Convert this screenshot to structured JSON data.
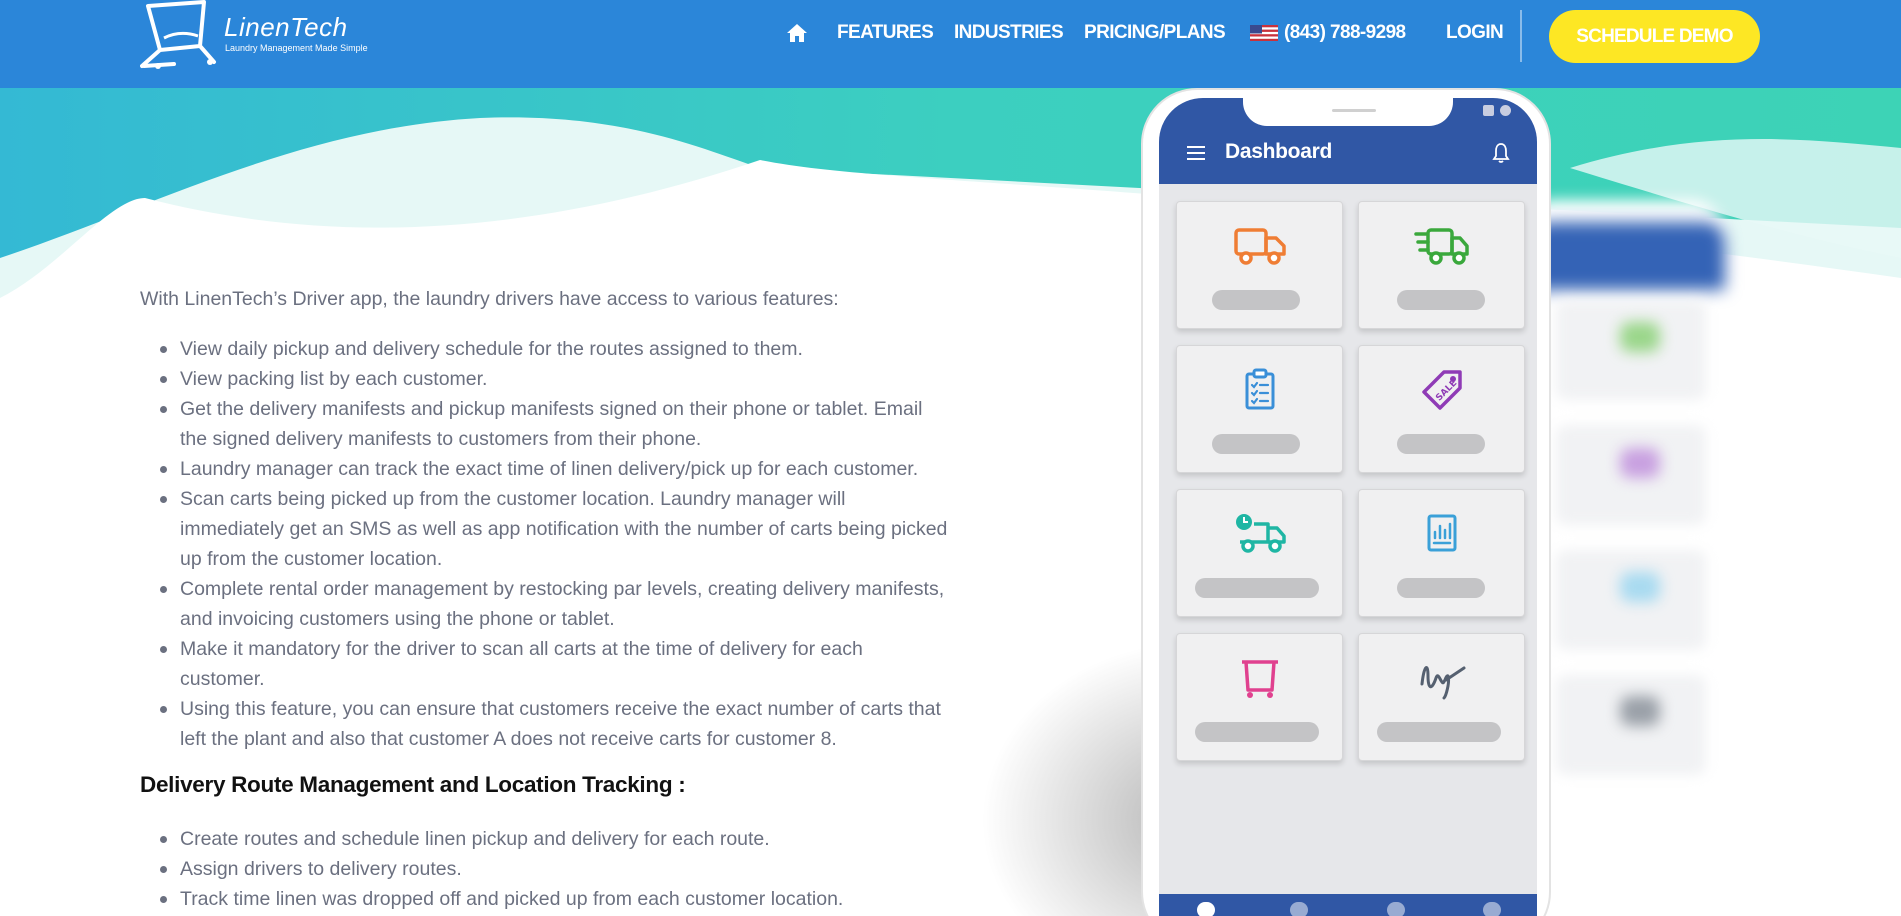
{
  "brand": {
    "name": "LinenTech",
    "tagline": "Laundry Management Made Simple"
  },
  "nav": {
    "home_icon": "home-icon",
    "features": "FEATURES",
    "industries": "INDUSTRIES",
    "pricing": "PRICING/PLANS",
    "phone": "(843) 788-9298",
    "login": "LOGIN",
    "cta": "SCHEDULE DEMO"
  },
  "content": {
    "intro": "With LinenTech’s Driver app, the laundry drivers have access to various features:",
    "driver_features": [
      "View daily pickup and delivery schedule for the routes assigned to them.",
      "View packing list by each customer.",
      "Get the delivery manifests and pickup manifests signed on their phone or tablet. Email the signed delivery manifests to customers from their phone.",
      "Laundry manager can track the exact time of linen delivery/pick up for each customer.",
      "Scan carts being picked up from the customer location. Laundry manager will immediately get an SMS as well as app notification with the number of carts being picked up from the customer location.",
      "Complete rental order management by restocking par levels, creating delivery manifests, and invoicing customers using the phone or tablet.",
      "Make it mandatory for the driver to scan all carts at the time of delivery for each customer.",
      "Using this feature, you can ensure that customers receive the exact number of carts that left the plant and also that customer A does not receive carts for customer 8."
    ],
    "section_title": "Delivery Route Management and Location Tracking :",
    "route_features": [
      "Create routes and schedule linen pickup and delivery for each route.",
      "Assign drivers to delivery routes.",
      "Track time linen was dropped off and picked up from each customer location."
    ]
  },
  "phone_app": {
    "title": "Dashboard",
    "tiles": [
      {
        "icon": "delivery-truck-icon",
        "color": "#ef7d34"
      },
      {
        "icon": "fast-truck-icon",
        "color": "#3aa83c"
      },
      {
        "icon": "clipboard-checklist-icon",
        "color": "#3a8fd8"
      },
      {
        "icon": "sale-tag-icon",
        "color": "#8f3bb6"
      },
      {
        "icon": "scheduled-truck-icon",
        "color": "#1fb6a4"
      },
      {
        "icon": "report-chart-icon",
        "color": "#3aa0d8"
      },
      {
        "icon": "laundry-cart-icon",
        "color": "#e0418f"
      },
      {
        "icon": "signature-icon",
        "color": "#556070"
      }
    ]
  },
  "colors": {
    "header_bg": "#2b86d9",
    "cta_bg": "#fde724",
    "wave_teal": "#3dcfbd",
    "app_blue": "#3057a5"
  }
}
